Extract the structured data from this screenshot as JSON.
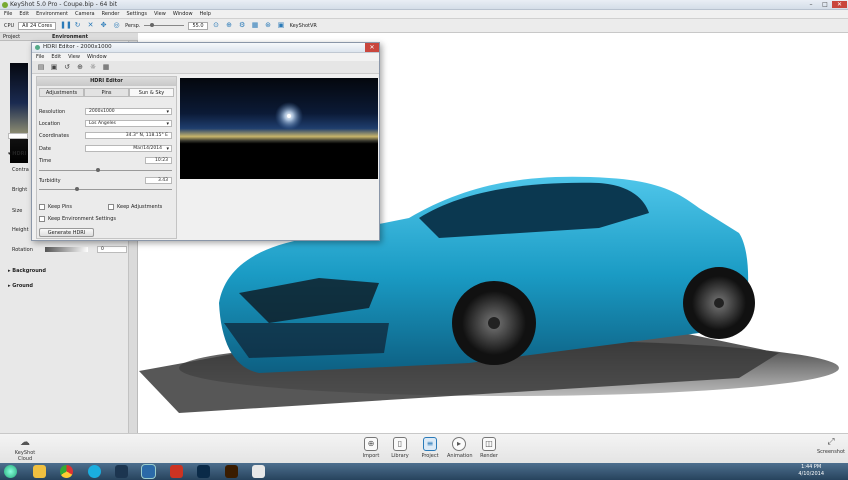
{
  "window": {
    "title": "KeyShot 5.0 Pro  -  Coupe.bip  -  64 bit"
  },
  "menu": [
    "File",
    "Edit",
    "Environment",
    "Camera",
    "Render",
    "Settings",
    "View",
    "Window",
    "Help"
  ],
  "toolbar": {
    "cpu_label": "CPU",
    "cores": "All 24 Cores",
    "persp_label": "Persp.",
    "persp_value": "55.0",
    "keyshotvr": "KeyShotVR"
  },
  "left_panel": {
    "tabs": [
      "Project",
      "Environment"
    ],
    "labels": {
      "hdri": "HDRI",
      "contrast": "Contra",
      "brightness": "Bright",
      "size": "Size",
      "height": "Height",
      "rotation": "Rotation",
      "rotation_value": "0",
      "background": "Background",
      "ground": "Ground"
    }
  },
  "hdri_editor": {
    "title": "HDRI Editor  -  2000x1000",
    "menu": [
      "File",
      "Edit",
      "View",
      "Window"
    ],
    "panel_title": "HDRI Editor",
    "tabs": [
      "Adjustments",
      "Pins",
      "Sun & Sky"
    ],
    "active_tab": "Sun & Sky",
    "fields": {
      "resolution_label": "Resolution",
      "resolution": "2000x1000",
      "location_label": "Location",
      "location": "Los Angeles",
      "coordinates_label": "Coordinates",
      "coordinates": "34.3° N, 118.15° E",
      "date_label": "Date",
      "date": "Mar/14/2014",
      "time_label": "Time",
      "time": "10:23",
      "turbidity_label": "Turbidity",
      "turbidity": "3.43"
    },
    "checkboxes": {
      "keep_pins": "Keep Pins",
      "keep_adjustments": "Keep Adjustments",
      "keep_env": "Keep Environment Settings"
    },
    "generate_button": "Generate HDRI"
  },
  "bottom_bar": {
    "cloud": "KeyShot Cloud",
    "items": [
      "Import",
      "Library",
      "Project",
      "Animation",
      "Render"
    ],
    "screenshot": "Screenshot"
  },
  "taskbar": {
    "time": "1:44 PM",
    "date": "4/10/2014"
  },
  "colors": {
    "car": "#1a9bc4",
    "accent": "#2a7ab8"
  }
}
